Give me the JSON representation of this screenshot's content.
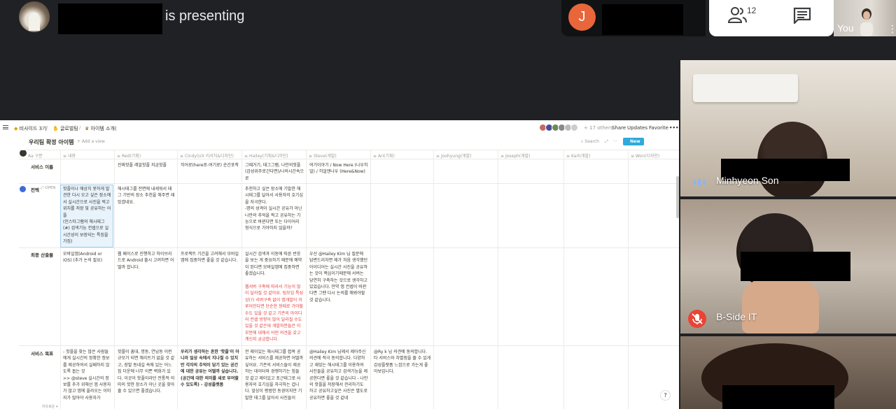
{
  "presentation": {
    "presenting_suffix": "is presenting"
  },
  "participant_pill": {
    "avatar_letter": "J"
  },
  "controls": {
    "people_count": "12",
    "self_label": "You"
  },
  "notion": {
    "breadcrumbs": [
      "비사이드 3기",
      "글로벌팀",
      "아이템 소개("
    ],
    "others_count": "+ 17 others",
    "share_label": "Share",
    "updates_label": "Updates",
    "favorite_label": "Favorite",
    "more_label": "•••",
    "db_title": "우리팀 확정 아이템",
    "add_view_label": "+ Add a view",
    "search_label": "Search",
    "new_label": "New",
    "open_label": "OPEN",
    "columns": [
      "구분",
      "내용",
      "Red(기획)",
      "Cindy(UX 리서치&디자인)",
      "Hailey(기획&디자인)",
      "Steve(개발)",
      "Ari(기획)",
      "Joohyung(개발)",
      "Joseph(개발)",
      "Karl(개발)",
      "Won(디자인)"
    ],
    "rows": [
      {
        "title": "서비스 이름",
        "cells": [
          "",
          "진짜핫플 레알핫플 지금핫플",
          "히어로(here로-여기로) 순간포착",
          "그때거기, 태그그램, 나만의핫플 (감성위주로간다면)/나의시간속으로",
          "여기이야기 / Now Here (나우히얼) / 히얼앤나우 (Here&Now)"
        ]
      },
      {
        "title": "컨텍",
        "cells": [
          "핫플이나 애상치 못하게 발견한 다시 오고 싶은 장소에서 실시간으로 사진을 찍고 위치를 저장 및 공유하는 어플\n(인스타그램의 해시태그 (#) 검색기능 컨셉으로 실시간성이 보장되는 특징을 가짐)",
          "해시태그를 전면에 내세워서 태그 기반의 장소 추천을 해주면 재밌겠네요.",
          "",
          "추천하고 싶은 장소에 기발한 해시태그를 달아서 사용자의 호기심을 자극한다.\n-명의 성격이 실시간 공유가 아닌 나만의 추억을 찍고 공유하는 기능으로 바뀐다면 또는 다이어리 형식으로 가야하지 않을까?"
        ]
      },
      {
        "title": "최종 산출물",
        "cells": [
          "모바일앱(Android or iOS) (추가 논의 필요)",
          "웹 페이스로 진행하고 하이브리드로 Android 출시 고려하면 어떨까 합니다.",
          "프로젝트 기간을 고려해서 모바일 앱에 집중하면 좋을 것 같습니다.",
          "실시간 검색과 이동에 따른 반응을 보는 게 중요하기 때문에 예약이 된다면 모바일앱에 집중하면 좋겠습니다.",
          "우선 @Hailey Kim 님 질문에 답변드리자면 제가 처음 생각했던 아이디어는 실시간 사진을 공유하는 것이 핵심이기때문에 서버는 당연히 구축하는 것으로 생각하고 있었습니다. 만약 앱 컨셉이 바뀐다면 그땐 다시 논의를 해봐야할 것 같습니다."
        ],
        "red_note": "웹서버 구축에 따라서 기능이 많이 달라질 것 같아요. 팀모임 특성상(?) 서버구축 없이 앱개발이 이루어진다면 단순한 형태로 가야할 수도 있을 것 같고 기존의 아이디어 컨셉 방향이 많이 달라질 수도 있을 것 같은데 개발자분들은 이 부분에 대해서 어떤 의견을 갖고 계신지 궁금합니다."
      },
      {
        "title": "서비스 목표",
        "cells": [
          "- 핫플을 찾는 많은 사람들에게 실시간의 정확한 정보를 제공하여서 실패하지 않도록 돕는 것\n>> @steve 실시간의 정보를 추가 위해선 앱 사용자가 많고 앱에 올라오는 이미지가 많아야 사용자가",
          "핫플이 흥대, 명동, 연남동 이런 규모가 되면 해리트가 없을 것 같고, 장발 동네길 속에 있는 어느 집 더운에 너무 이쁜 벽화가 있다. 이곳이 핫플이라던 전통적 의미의 핫한 장소가 아닌 곳을 찾아줄 수 있으면 좋겠습니다.",
          "우리가 생각하는 흔한 '핫플'이 아니라 일상 속에서 지나칠 수 있지만 각자의 추억이 담기 있는 공간에 대한 공유는 어떨까 싶습니다. (공간에 대한 의미를 새로 부여할 수 있도록) - 감성플랫폼",
          "전 제이있는 해시태그를 접목 공유하는 서비스를 제공하면 어떨까 싶어요. 기존의 서비스들이 제공하는 데이터와 경쟁하기는 힘들 것 같고 제이있고 포근태그로 사용자의 호기심을 자극하는 겁니다. 앞상이 평범한 동경이지만 기발한 태그를 달아서 사진들이",
          "@Hailey Kim 님께서 제아주신 의견에 적극 동의합니다. 다양하고 재밌는 해시태그를 이용하여 사진들을 공유하고 검색기능을 제공한다면 좋을 것 같습니다 - 나만의 핫플을 저장해서 관리하기도 하고 공유하고싶은 사진은 별도로 공유하면 좋을 것 같네",
          "@Ry k 님 의견에 동의합니다. 타 서비스와 차별점을 줄 수 있게 감성플랫폼 느낌으로 가는게 좋아보입니다."
        ]
      }
    ],
    "footer": "자유로운 ▾"
  },
  "side_tiles": [
    {
      "label": "Minhyeon Son"
    },
    {
      "label": "B-Side IT"
    }
  ],
  "help_label": "?"
}
